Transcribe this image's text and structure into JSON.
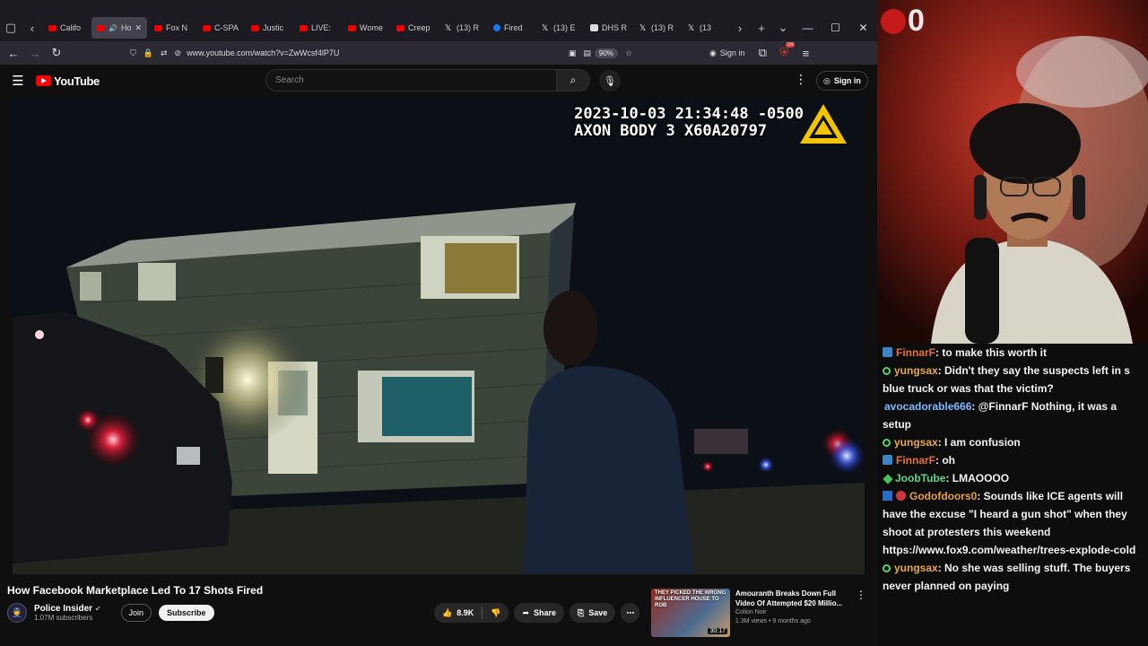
{
  "browser": {
    "tabs": [
      {
        "label": "Califo",
        "icon": "youtube-icon"
      },
      {
        "label": "Ho",
        "icon": "youtube-icon",
        "active": true,
        "audio": true
      },
      {
        "label": "Fox N",
        "icon": "youtube-icon"
      },
      {
        "label": "C-SPA",
        "icon": "youtube-icon"
      },
      {
        "label": "Justic",
        "icon": "youtube-icon"
      },
      {
        "label": "LIVE:",
        "icon": "youtube-icon"
      },
      {
        "label": "Wome",
        "icon": "youtube-icon"
      },
      {
        "label": "Creep",
        "icon": "youtube-icon"
      },
      {
        "label": "(13) R",
        "icon": "x-icon"
      },
      {
        "label": "Fired",
        "icon": "facebook-icon"
      },
      {
        "label": "(13) E",
        "icon": "x-icon"
      },
      {
        "label": "DHS R",
        "icon": "dhs-icon"
      },
      {
        "label": "(13) R",
        "icon": "x-icon"
      },
      {
        "label": "(13",
        "icon": "x-icon"
      }
    ],
    "url": "www.youtube.com/watch?v=ZwWcsf4lP7U",
    "zoom": "90%",
    "signin": "Sign in",
    "ext_badge": "390"
  },
  "youtube": {
    "logo": "YouTube",
    "search_placeholder": "Search",
    "signin": "Sign in",
    "video": {
      "timestamp": "2023-10-03 21:34:48 -0500",
      "device": "AXON BODY 3 X60A20797"
    },
    "title": "How Facebook Marketplace Led To 17 Shots Fired",
    "channel": {
      "name": "Police Insider",
      "subs": "1.07M subscribers"
    },
    "join": "Join",
    "subscribe": "Subscribe",
    "likes": "8.9K",
    "share": "Share",
    "save": "Save",
    "recommendation": {
      "thumb_text": "THEY PICKED THE WRONG INFLUENCER HOUSE TO ROB",
      "duration": "30:17",
      "title": "Amouranth Breaks Down Full Video Of Attempted $20 Millio...",
      "channel": "Colion Noir",
      "meta": "1.3M views • 9 months ago"
    }
  },
  "stream": {
    "overlay_count": "0",
    "chat": [
      {
        "user": "FinnarF",
        "badge": "sub",
        "text": ": to make this worth it",
        "cls": "u1"
      },
      {
        "user": "yungsax",
        "badge": "person",
        "text": ": Didn't they say the suspects left in s blue truck or was that the victim?",
        "cls": "u2"
      },
      {
        "user": "avocadorable666",
        "badge": "",
        "text": ": @FinnarF Nothing, it was a setup",
        "cls": "u3"
      },
      {
        "user": "yungsax",
        "badge": "person",
        "text": ": I am confusion",
        "cls": "u2"
      },
      {
        "user": "FinnarF",
        "badge": "sub",
        "text": ": oh",
        "cls": "u1"
      },
      {
        "user": "JoobTube",
        "badge": "diamond",
        "text": ": LMAOOOO",
        "cls": "u5"
      },
      {
        "user": "Godofdoors0",
        "badge": "blue2",
        "text": ": Sounds like ICE agents will have the excuse \"I heard a gun shot\" when they shoot at protesters this weekend https://www.fox9.com/weather/trees-explode-cold",
        "cls": "u6"
      },
      {
        "user": "yungsax",
        "badge": "person",
        "text": ": No she was selling stuff. The buyers never planned on paying",
        "cls": "u2"
      }
    ]
  }
}
